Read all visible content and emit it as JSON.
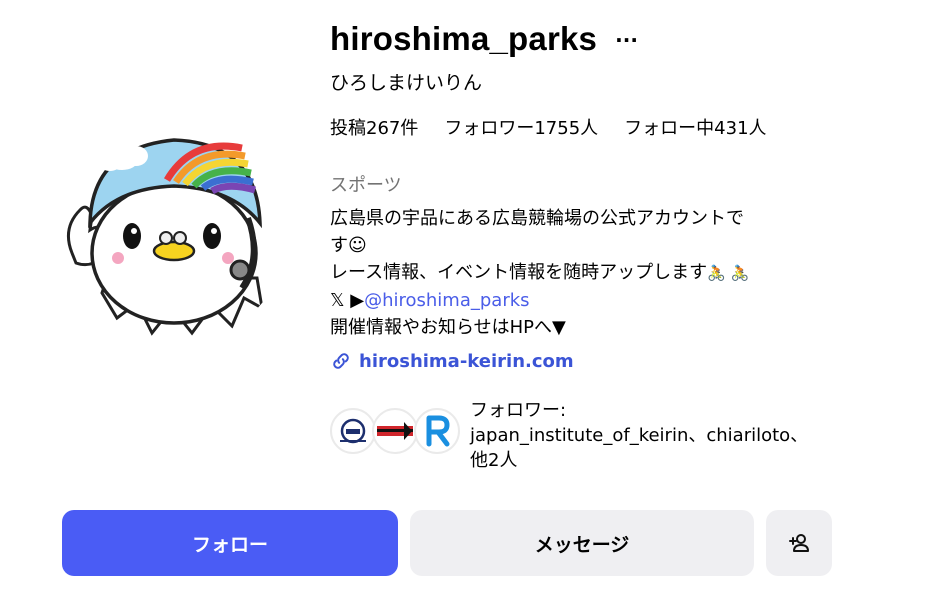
{
  "profile": {
    "username": "hiroshima_parks",
    "more_icon": "...",
    "full_name": "ひろしまけいりん",
    "stats": {
      "posts": "投稿267件",
      "followers": "フォロワー1755人",
      "following": "フォロー中431人"
    },
    "category": "スポーツ",
    "bio": {
      "line1": "広島県の宇品にある広島競輪場の公式アカウントで",
      "line2": "す☺",
      "line3": "レース情報、イベント情報を随時アップします",
      "line3_emoji": "🚴 🚴",
      "line4_prefix": "𝕏 ▶",
      "line4_mention": "@hiroshima_parks",
      "line5": "開催情報やお知らせはHPへ▼"
    },
    "link": "hiroshima-keirin.com",
    "followed_by": {
      "label": "フォロワー:",
      "names": "japan_institute_of_keirin、chiariloto、",
      "others": "他2人"
    }
  },
  "actions": {
    "follow": "フォロー",
    "message": "メッセージ",
    "add_user_icon": "add-user-icon"
  },
  "colors": {
    "follow_button": "#4a5cf5",
    "secondary_button": "#efeff2",
    "link": "#3b54d6",
    "mention": "#4a5de8",
    "category": "#737373"
  }
}
